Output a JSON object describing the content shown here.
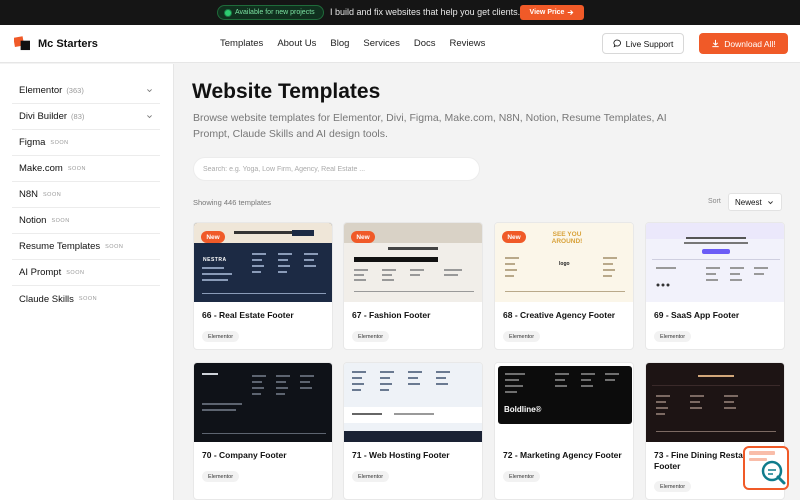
{
  "announcement": {
    "availability": "Available for new projects",
    "message": "I build and fix websites that help you get clients.",
    "cta": "View Price"
  },
  "header": {
    "brand": "Mc Starters",
    "nav": [
      "Templates",
      "About Us",
      "Blog",
      "Services",
      "Docs",
      "Reviews"
    ],
    "live_support": "Live Support",
    "download_all": "Download All!"
  },
  "sidebar": {
    "items": [
      {
        "label": "Elementor",
        "count": "(363)",
        "expandable": true
      },
      {
        "label": "Divi Builder",
        "count": "(83)",
        "expandable": true
      },
      {
        "label": "Figma",
        "soon": "SOON"
      },
      {
        "label": "Make.com",
        "soon": "SOON"
      },
      {
        "label": "N8N",
        "soon": "SOON"
      },
      {
        "label": "Notion",
        "soon": "SOON"
      },
      {
        "label": "Resume Templates",
        "soon": "SOON"
      },
      {
        "label": "AI Prompt",
        "soon": "SOON"
      },
      {
        "label": "Claude Skills",
        "soon": "SOON"
      }
    ]
  },
  "main": {
    "title": "Website Templates",
    "description": "Browse website templates for Elementor, Divi, Figma, Make.com, N8N, Notion, Resume Templates, AI Prompt, Claude Skills and AI design tools.",
    "search_placeholder": "Search: e.g. Yoga, Low Firm, Agency, Real Estate ...",
    "showing": "Showing 446 templates",
    "sort_label": "Sort",
    "sort_value": "Newest"
  },
  "cards": [
    {
      "title": "66 - Real Estate Footer",
      "tag": "Elementor",
      "badge": "New",
      "thumb": "real-estate",
      "thumb_text": "NESTRA"
    },
    {
      "title": "67 - Fashion Footer",
      "tag": "Elementor",
      "badge": "New",
      "thumb": "fashion"
    },
    {
      "title": "68 - Creative Agency Footer",
      "tag": "Elementor",
      "badge": "New",
      "thumb": "creative",
      "thumb_text": "SEE YOU AROUND!",
      "thumb_logo": "logo"
    },
    {
      "title": "69 - SaaS App Footer",
      "tag": "Elementor",
      "thumb": "saas"
    },
    {
      "title": "70 - Company Footer",
      "tag": "Elementor",
      "thumb": "company"
    },
    {
      "title": "71 - Web Hosting Footer",
      "tag": "Elementor",
      "thumb": "hosting"
    },
    {
      "title": "72 - Marketing Agency Footer",
      "tag": "Elementor",
      "thumb": "marketing",
      "thumb_text": "Boldline®"
    },
    {
      "title": "73 - Fine Dining Restaurant Footer",
      "tag": "Elementor",
      "thumb": "dining"
    }
  ],
  "colors": {
    "accent": "#f05a28",
    "dark": "#151515",
    "available_green": "#2ecc71"
  }
}
